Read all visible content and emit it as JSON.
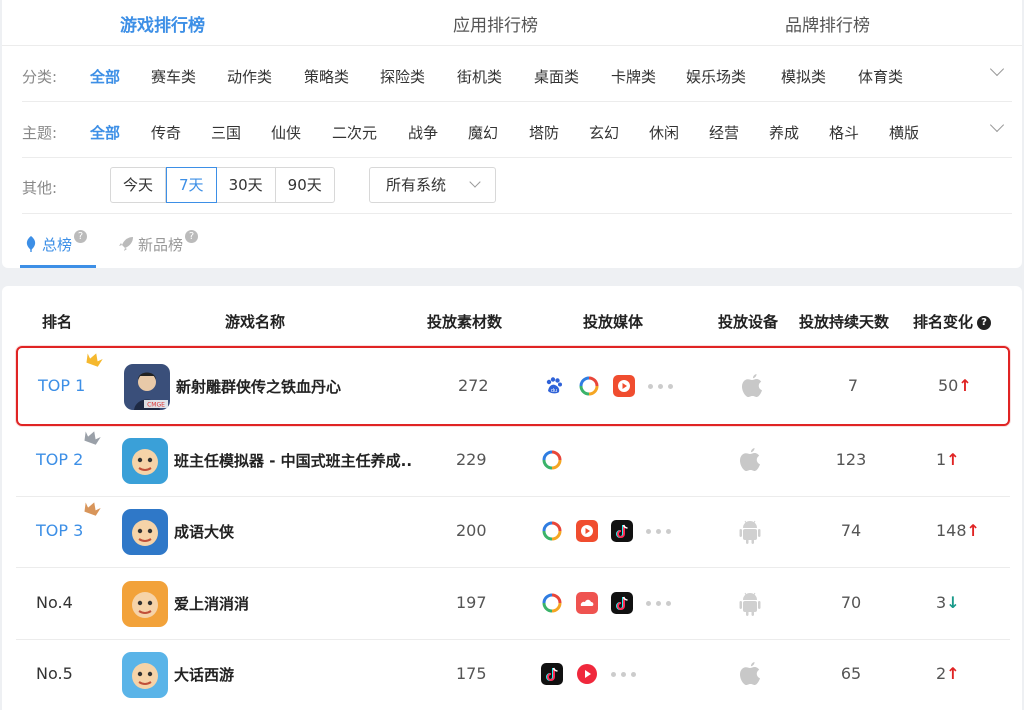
{
  "main_tabs": [
    "游戏排行榜",
    "应用排行榜",
    "品牌排行榜"
  ],
  "filters": {
    "category": {
      "label": "分类:",
      "items": [
        "全部",
        "赛车类",
        "动作类",
        "策略类",
        "探险类",
        "街机类",
        "桌面类",
        "卡牌类",
        "娱乐场类",
        "模拟类",
        "体育类"
      ]
    },
    "theme": {
      "label": "主题:",
      "items": [
        "全部",
        "传奇",
        "三国",
        "仙侠",
        "二次元",
        "战争",
        "魔幻",
        "塔防",
        "玄幻",
        "休闲",
        "经营",
        "养成",
        "格斗",
        "横版"
      ]
    },
    "other": {
      "label": "其他:",
      "periods": [
        "今天",
        "7天",
        "30天",
        "90天"
      ],
      "active_period": "7天",
      "system_select": "所有系统"
    }
  },
  "sub_tabs": [
    "总榜",
    "新品榜"
  ],
  "qmark": "?",
  "table": {
    "headers": [
      "排名",
      "游戏名称",
      "投放素材数",
      "投放媒体",
      "投放设备",
      "投放持续天数",
      "排名变化"
    ],
    "rows": [
      {
        "rank": "TOP 1",
        "name": "新射雕群侠传之铁血丹心",
        "count": "272",
        "media": [
          "baidu",
          "ring",
          "video-red"
        ],
        "more": true,
        "device": "apple",
        "days": "7",
        "change": "50",
        "dir": "up",
        "crown": "#f5b82e",
        "icon_bg": "#3a4f7a",
        "icon_label": "CMGE"
      },
      {
        "rank": "TOP 2",
        "name": "班主任模拟器 - 中国式班主任养成..",
        "count": "229",
        "media": [
          "ring"
        ],
        "more": false,
        "device": "apple",
        "days": "123",
        "change": "1",
        "dir": "up",
        "crown": "#9aa0a8",
        "icon_bg": "#3aa0d8",
        "icon_label": ""
      },
      {
        "rank": "TOP 3",
        "name": "成语大侠",
        "count": "200",
        "media": [
          "ring",
          "video-red",
          "tiktok"
        ],
        "more": true,
        "device": "android",
        "days": "74",
        "change": "148",
        "dir": "up",
        "crown": "#d8955a",
        "icon_bg": "#2f78c8",
        "icon_label": ""
      },
      {
        "rank": "No.4",
        "name": "爱上消消消",
        "count": "197",
        "media": [
          "ring",
          "cloud-red",
          "tiktok"
        ],
        "more": true,
        "device": "android",
        "days": "70",
        "change": "3",
        "dir": "down",
        "crown": "",
        "icon_bg": "#f2a23a",
        "icon_label": ""
      },
      {
        "rank": "No.5",
        "name": "大话西游",
        "count": "175",
        "media": [
          "tiktok",
          "play-red"
        ],
        "more": true,
        "device": "apple",
        "days": "65",
        "change": "2",
        "dir": "up",
        "crown": "",
        "icon_bg": "#5ab4e8",
        "icon_label": ""
      }
    ]
  }
}
